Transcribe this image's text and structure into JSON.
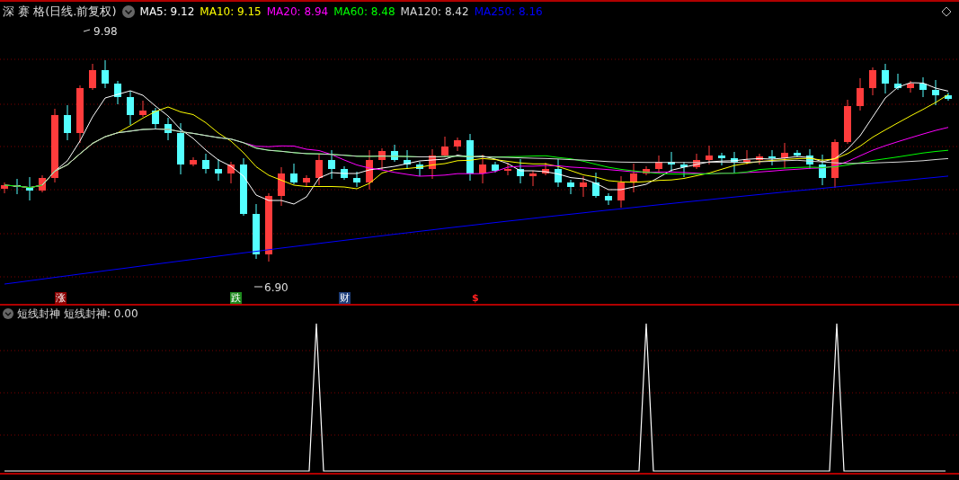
{
  "main_chart": {
    "title": "深 赛 格(日线.前复权)",
    "indicators": [
      {
        "label": "MA5: 9.12",
        "color": "#ffffff"
      },
      {
        "label": "MA10: 9.15",
        "color": "#ffff00"
      },
      {
        "label": "MA20: 8.94",
        "color": "#ff00ff"
      },
      {
        "label": "MA60: 8.48",
        "color": "#00ff00"
      },
      {
        "label": "MA120: 8.42",
        "color": "#d8d8d8"
      },
      {
        "label": "MA250: 8.16",
        "color": "#0000ff"
      }
    ],
    "high_label": "9.98",
    "low_label": "6.90",
    "markers": [
      {
        "text": "涨",
        "kind": "up"
      },
      {
        "text": "跌",
        "kind": "down"
      },
      {
        "text": "财",
        "kind": "finance"
      },
      {
        "text": "$",
        "kind": "dollar"
      }
    ]
  },
  "sub_chart": {
    "title": "短线封神",
    "reading": "短线封神: 0.00"
  }
}
